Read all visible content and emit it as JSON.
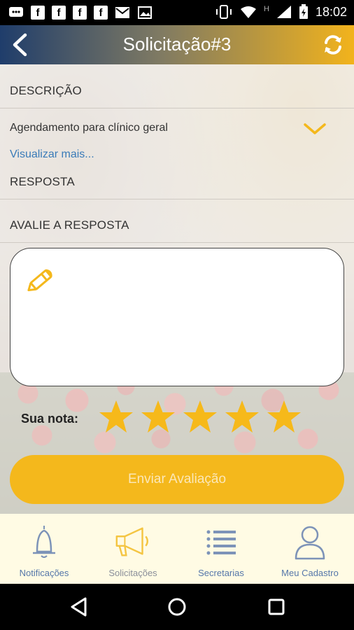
{
  "status_bar": {
    "time": "18:02",
    "network_label": "H"
  },
  "header": {
    "title": "Solicitação#3"
  },
  "sections": {
    "descricao_label": "DESCRIÇÃO",
    "descricao_text": "Agendamento para clínico geral",
    "visualizar_mais": "Visualizar mais...",
    "resposta_label": "RESPOSTA",
    "avalie_label": "AVALIE A RESPOSTA"
  },
  "rating": {
    "label": "Sua nota:",
    "stars_filled": 5,
    "stars_total": 5
  },
  "send_button": {
    "label": "Enviar Avaliação"
  },
  "bottom_nav": {
    "items": [
      {
        "label": "Notificações",
        "icon": "bell-icon"
      },
      {
        "label": "Solicitações",
        "icon": "megaphone-icon"
      },
      {
        "label": "Secretarias",
        "icon": "list-icon"
      },
      {
        "label": "Meu Cadastro",
        "icon": "user-icon"
      }
    ]
  },
  "colors": {
    "accent": "#f4b81c",
    "header_start": "#1f3d6b",
    "link": "#3a7bb8",
    "nav_label": "#5577aa"
  }
}
